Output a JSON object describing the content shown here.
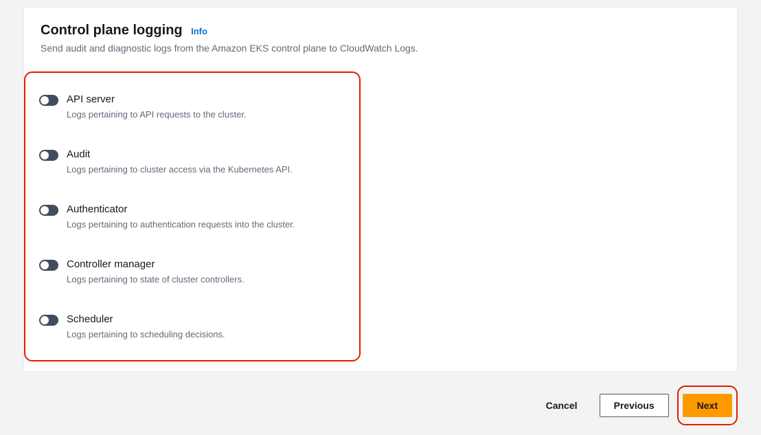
{
  "panel": {
    "title": "Control plane logging",
    "info_label": "Info",
    "subtitle": "Send audit and diagnostic logs from the Amazon EKS control plane to CloudWatch Logs."
  },
  "options": [
    {
      "label": "API server",
      "desc": "Logs pertaining to API requests to the cluster."
    },
    {
      "label": "Audit",
      "desc": "Logs pertaining to cluster access via the Kubernetes API."
    },
    {
      "label": "Authenticator",
      "desc": "Logs pertaining to authentication requests into the cluster."
    },
    {
      "label": "Controller manager",
      "desc": "Logs pertaining to state of cluster controllers."
    },
    {
      "label": "Scheduler",
      "desc": "Logs pertaining to scheduling decisions."
    }
  ],
  "footer": {
    "cancel": "Cancel",
    "previous": "Previous",
    "next": "Next"
  }
}
